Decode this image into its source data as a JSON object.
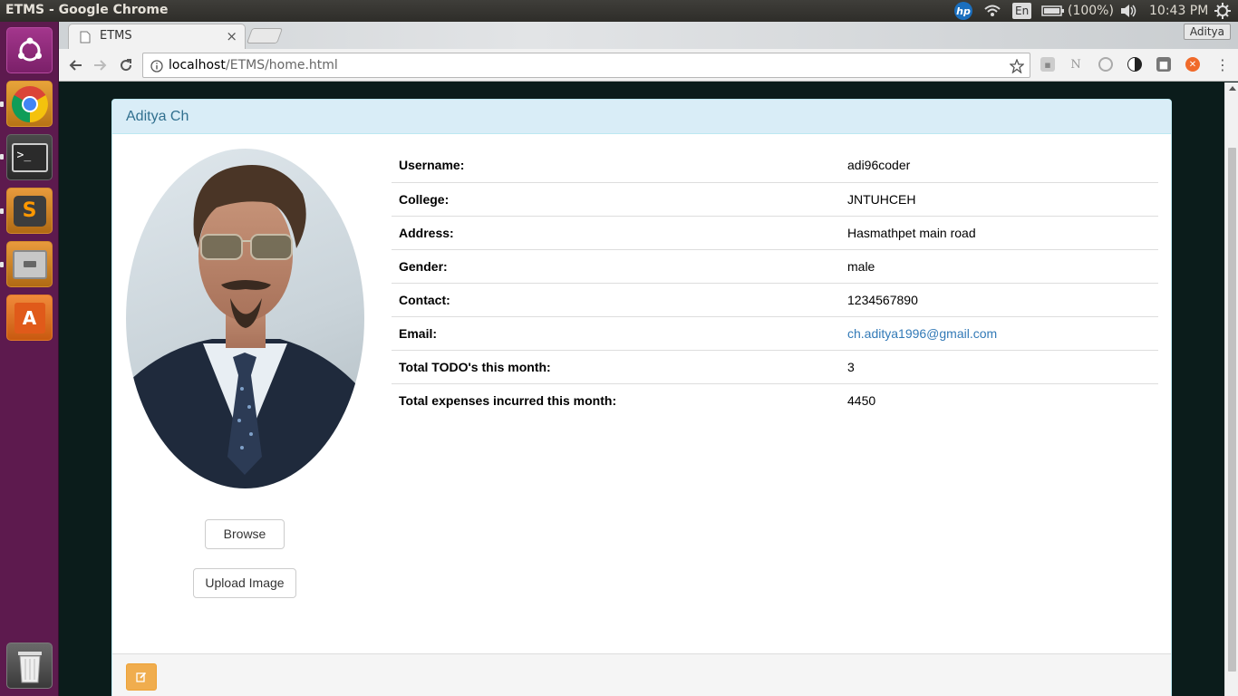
{
  "window": {
    "title": "ETMS - Google Chrome"
  },
  "tray": {
    "keyboard": "En",
    "battery": "(100%)",
    "time": "10:43 PM"
  },
  "browser": {
    "tab_title": "ETMS",
    "profile": "Aditya",
    "url_host": "localhost",
    "url_path": "/ETMS/home.html"
  },
  "panel": {
    "heading": "Aditya Ch",
    "browse_label": "Browse",
    "upload_label": "Upload Image",
    "rows": [
      {
        "key": "Username:",
        "value": "adi96coder"
      },
      {
        "key": "College:",
        "value": "JNTUHCEH"
      },
      {
        "key": "Address:",
        "value": "Hasmathpet main road"
      },
      {
        "key": "Gender:",
        "value": "male"
      },
      {
        "key": "Contact:",
        "value": "1234567890"
      },
      {
        "key": "Email:",
        "value": "ch.aditya1996@gmail.com"
      },
      {
        "key": "Total TODO's this month:",
        "value": "3"
      },
      {
        "key": "Total expenses incurred this month:",
        "value": "4450"
      }
    ]
  },
  "colors": {
    "heading_bg": "#d9edf7",
    "heading_text": "#31708f",
    "link": "#337ab7",
    "warning_button": "#f0ad4e",
    "launcher": "#5d1a4e"
  },
  "launcher_icons": [
    "ubuntu-dash-icon",
    "chrome-icon",
    "terminal-icon",
    "sublime-text-icon",
    "file-manager-icon",
    "software-center-icon",
    "trash-icon"
  ]
}
